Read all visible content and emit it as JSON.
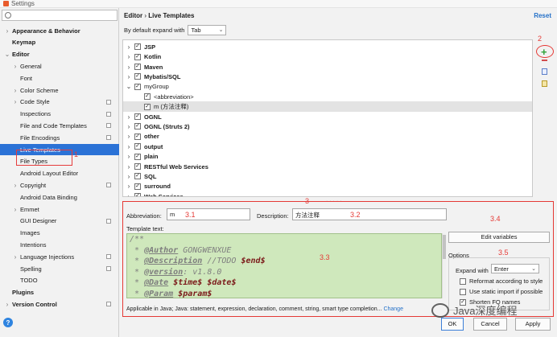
{
  "window": {
    "title": "Settings"
  },
  "sidebar": {
    "items": [
      {
        "label": "Appearance & Behavior",
        "level": 0,
        "arrow": "›",
        "bold": true,
        "copy": false
      },
      {
        "label": "Keymap",
        "level": 0,
        "arrow": "",
        "bold": true,
        "copy": false
      },
      {
        "label": "Editor",
        "level": 0,
        "arrow": "⌄",
        "bold": true,
        "copy": false
      },
      {
        "label": "General",
        "level": 1,
        "arrow": "›",
        "bold": false,
        "copy": false
      },
      {
        "label": "Font",
        "level": 1,
        "arrow": "",
        "bold": false,
        "copy": false
      },
      {
        "label": "Color Scheme",
        "level": 1,
        "arrow": "›",
        "bold": false,
        "copy": false
      },
      {
        "label": "Code Style",
        "level": 1,
        "arrow": "›",
        "bold": false,
        "copy": true
      },
      {
        "label": "Inspections",
        "level": 1,
        "arrow": "",
        "bold": false,
        "copy": true
      },
      {
        "label": "File and Code Templates",
        "level": 1,
        "arrow": "",
        "bold": false,
        "copy": true
      },
      {
        "label": "File Encodings",
        "level": 1,
        "arrow": "",
        "bold": false,
        "copy": true
      },
      {
        "label": "Live Templates",
        "level": 1,
        "arrow": "",
        "bold": false,
        "copy": false,
        "selected": true
      },
      {
        "label": "File Types",
        "level": 1,
        "arrow": "",
        "bold": false,
        "copy": false
      },
      {
        "label": "Android Layout Editor",
        "level": 1,
        "arrow": "",
        "bold": false,
        "copy": false
      },
      {
        "label": "Copyright",
        "level": 1,
        "arrow": "›",
        "bold": false,
        "copy": true
      },
      {
        "label": "Android Data Binding",
        "level": 1,
        "arrow": "",
        "bold": false,
        "copy": false
      },
      {
        "label": "Emmet",
        "level": 1,
        "arrow": "›",
        "bold": false,
        "copy": false
      },
      {
        "label": "GUI Designer",
        "level": 1,
        "arrow": "",
        "bold": false,
        "copy": true
      },
      {
        "label": "Images",
        "level": 1,
        "arrow": "",
        "bold": false,
        "copy": false
      },
      {
        "label": "Intentions",
        "level": 1,
        "arrow": "",
        "bold": false,
        "copy": false
      },
      {
        "label": "Language Injections",
        "level": 1,
        "arrow": "›",
        "bold": false,
        "copy": true
      },
      {
        "label": "Spelling",
        "level": 1,
        "arrow": "",
        "bold": false,
        "copy": true
      },
      {
        "label": "TODO",
        "level": 1,
        "arrow": "",
        "bold": false,
        "copy": false
      },
      {
        "label": "Plugins",
        "level": 0,
        "arrow": "",
        "bold": true,
        "copy": false
      },
      {
        "label": "Version Control",
        "level": 0,
        "arrow": "›",
        "bold": true,
        "copy": true
      }
    ],
    "annotation": "1",
    "help_glyph": "?"
  },
  "header": {
    "breadcrumb_section": "Editor",
    "breadcrumb_sep": "›",
    "breadcrumb_page": "Live Templates",
    "reset_label": "Reset"
  },
  "expand": {
    "label": "By default expand with",
    "value": "Tab"
  },
  "templates": {
    "groups": [
      {
        "label": "JSP",
        "arrow": "›",
        "indent": 0,
        "bold": true,
        "checked": true
      },
      {
        "label": "Kotlin",
        "arrow": "›",
        "indent": 0,
        "bold": true,
        "checked": true
      },
      {
        "label": "Maven",
        "arrow": "›",
        "indent": 0,
        "bold": true,
        "checked": true
      },
      {
        "label": "Mybatis/SQL",
        "arrow": "›",
        "indent": 0,
        "bold": true,
        "checked": true
      },
      {
        "label": "myGroup",
        "arrow": "⌄",
        "indent": 0,
        "bold": false,
        "checked": true
      },
      {
        "label": "<abbreviation>",
        "arrow": "",
        "indent": 1,
        "bold": false,
        "checked": true
      },
      {
        "label": "m (方法注释)",
        "arrow": "",
        "indent": 1,
        "bold": false,
        "checked": true,
        "selected": true
      },
      {
        "label": "OGNL",
        "arrow": "›",
        "indent": 0,
        "bold": true,
        "checked": true
      },
      {
        "label": "OGNL (Struts 2)",
        "arrow": "›",
        "indent": 0,
        "bold": true,
        "checked": true
      },
      {
        "label": "other",
        "arrow": "›",
        "indent": 0,
        "bold": true,
        "checked": true
      },
      {
        "label": "output",
        "arrow": "›",
        "indent": 0,
        "bold": true,
        "checked": true
      },
      {
        "label": "plain",
        "arrow": "›",
        "indent": 0,
        "bold": true,
        "checked": true
      },
      {
        "label": "RESTful Web Services",
        "arrow": "›",
        "indent": 0,
        "bold": true,
        "checked": true
      },
      {
        "label": "SQL",
        "arrow": "›",
        "indent": 0,
        "bold": true,
        "checked": true
      },
      {
        "label": "surround",
        "arrow": "›",
        "indent": 0,
        "bold": true,
        "checked": true
      },
      {
        "label": "Web Services",
        "arrow": "›",
        "indent": 0,
        "bold": true,
        "checked": true
      }
    ]
  },
  "toolbar": {
    "annotation": "2",
    "add_glyph": "+"
  },
  "editor": {
    "section_annotation": "3",
    "abbreviation_label": "Abbreviation:",
    "abbreviation_value": "m",
    "abbreviation_annotation": "3.1",
    "description_label": "Description:",
    "description_value": "方法注释",
    "description_annotation": "3.2",
    "edit_variables_label": "Edit variables",
    "edit_variables_annotation": "3.4",
    "template_text_label": "Template text:",
    "template_annotation": "3.3",
    "template_lines": [
      [
        "/**"
      ],
      [
        " * ",
        "@Author",
        " GONGWENXUE"
      ],
      [
        " * ",
        "@Description",
        " //TODO ",
        "$end$"
      ],
      [
        " * ",
        "@version",
        ": v1.8.0"
      ],
      [
        " * ",
        "@Date",
        " ",
        "$time$ $date$"
      ],
      [
        " * ",
        "@Param",
        " ",
        "$param$"
      ]
    ],
    "applicable_text": "Applicable in Java; Java: statement, expression, declaration, comment, string, smart type completion...",
    "change_link": "Change",
    "options_label": "Options",
    "options_annotation": "3.5",
    "expand_with_label": "Expand with",
    "expand_with_value": "Enter",
    "reformat_label": "Reformat according to style",
    "reformat_checked": false,
    "static_import_label": "Use static import if possible",
    "static_import_checked": false,
    "shorten_label": "Shorten FQ names",
    "shorten_checked": true
  },
  "footer": {
    "ok_label": "OK",
    "cancel_label": "Cancel",
    "apply_label": "Apply"
  },
  "watermark": {
    "text": "Java深度编程"
  },
  "colors": {
    "selection": "#2b72d6",
    "annotation": "#e53935",
    "code_bg": "#cfe8bc",
    "link": "#2470c8"
  }
}
